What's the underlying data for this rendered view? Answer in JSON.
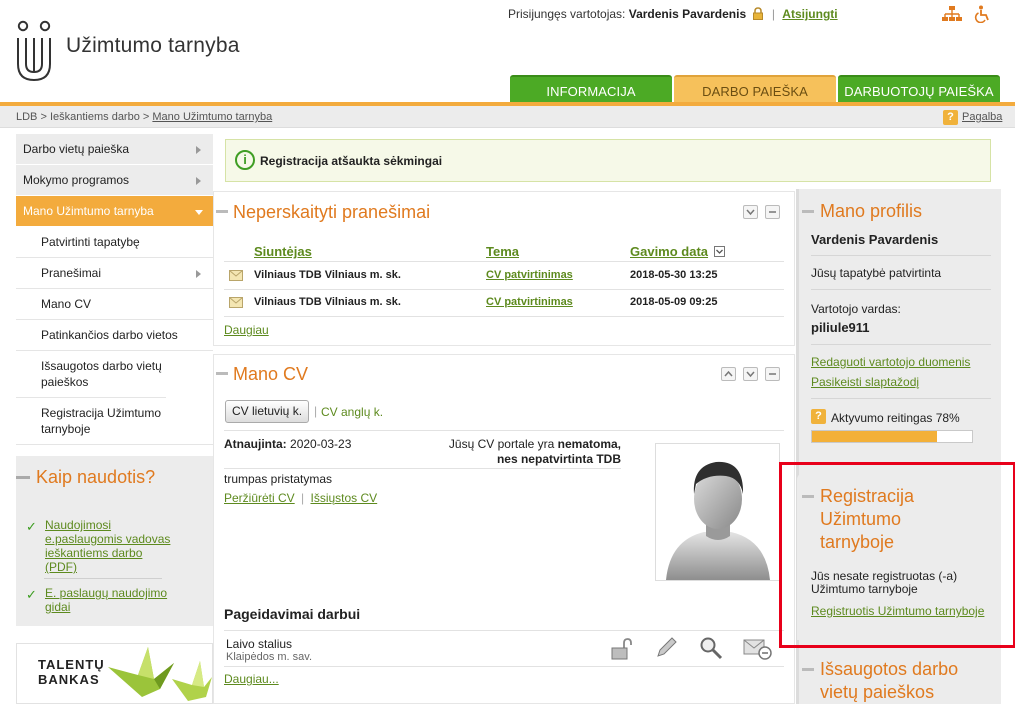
{
  "header": {
    "brand": "Užimtumo tarnyba",
    "user_prefix": "Prisijungęs vartotojas:",
    "user_name": "Vardenis Pavardenis",
    "logout": "Atsijungti",
    "icons": [
      "sitemap-icon",
      "accessibility-icon",
      "lock-icon"
    ]
  },
  "tabs": [
    {
      "label": "INFORMACIJA"
    },
    {
      "label": "DARBO PAIEŠKA"
    },
    {
      "label": "DARBUOTOJŲ PAIEŠKA"
    }
  ],
  "breadcrumb": {
    "part1": "LDB",
    "sep": " > ",
    "part2": "Ieškantiems darbo",
    "part3": "Mano Užimtumo tarnyba",
    "help": "Pagalba"
  },
  "leftnav": {
    "items": [
      {
        "label": "Darbo vietų paieška"
      },
      {
        "label": "Mokymo programos"
      },
      {
        "label": "Mano Užimtumo tarnyba"
      }
    ],
    "subitems": [
      {
        "label": "Patvirtinti tapatybę"
      },
      {
        "label": "Pranešimai"
      },
      {
        "label": "Mano CV"
      },
      {
        "label": "Patinkančios darbo vietos"
      },
      {
        "label": "Išsaugotos darbo vietų paieškos"
      },
      {
        "label": "Registracija Užimtumo tarnyboje"
      }
    ]
  },
  "howto": {
    "title": "Kaip naudotis?",
    "links": [
      "Naudojimosi e.paslaugomis vadovas ieškantiems darbo (PDF)",
      "E. paslaugų naudojimo gidai"
    ]
  },
  "talent": {
    "line1": "TALENTŲ",
    "line2": "BANKAS"
  },
  "success": {
    "text": "Registracija atšaukta sėkmingai"
  },
  "messages": {
    "title": "Neperskaityti pranešimai",
    "headers": {
      "sender": "Siuntėjas",
      "topic": "Tema",
      "date": "Gavimo data"
    },
    "rows": [
      {
        "sender": "Vilniaus TDB Vilniaus m. sk.",
        "topic": "CV patvirtinimas",
        "date": "2018-05-30 13:25"
      },
      {
        "sender": "Vilniaus TDB Vilniaus m. sk.",
        "topic": "CV patvirtinimas",
        "date": "2018-05-09 09:25"
      }
    ],
    "more": "Daugiau"
  },
  "cv": {
    "title": "Mano CV",
    "tab_lt": "CV lietuvių k.",
    "tab_en": "CV anglų k.",
    "updated_label": "Atnaujinta:",
    "updated_value": "2020-03-23",
    "status_pre": "Jūsų CV portale yra",
    "status_bold": "nematoma,",
    "status_line2": "nes nepatvirtinta TDB",
    "summary": "trumpas pristatymas",
    "view": "Peržiūrėti CV",
    "send": "Išsiųstos CV",
    "wishes_title": "Pageidavimai darbui",
    "wish_job": "Laivo stalius",
    "wish_place": "Klaipėdos m. sav.",
    "more": "Daugiau..."
  },
  "profile": {
    "title": "Mano profilis",
    "name": "Vardenis Pavardenis",
    "identity": "Jūsų tapatybė patvirtinta",
    "username_label": "Vartotojo vardas:",
    "username": "piliule911",
    "edit": "Redaguoti vartotojo duomenis",
    "change_pw": "Pasikeisti slaptažodį",
    "rating_label": "Aktyvumo reitingas 78%",
    "rating": 78
  },
  "registration": {
    "title_l1": "Registracija",
    "title_l2": "Užimtumo",
    "title_l3": "tarnyboje",
    "status_l1": "Jūs nesate registruotas (-a)",
    "status_l2": "Užimtumo tarnyboje",
    "link": "Registruotis Užimtumo tarnyboje"
  },
  "saved": {
    "title_l1": "Išsaugotos darbo",
    "title_l2": "vietų paieškos"
  },
  "colors": {
    "accent_orange": "#e07a1f",
    "green_tab": "#4caa25",
    "link_green": "#5d8a1e",
    "highlight_red": "#e8001a"
  }
}
